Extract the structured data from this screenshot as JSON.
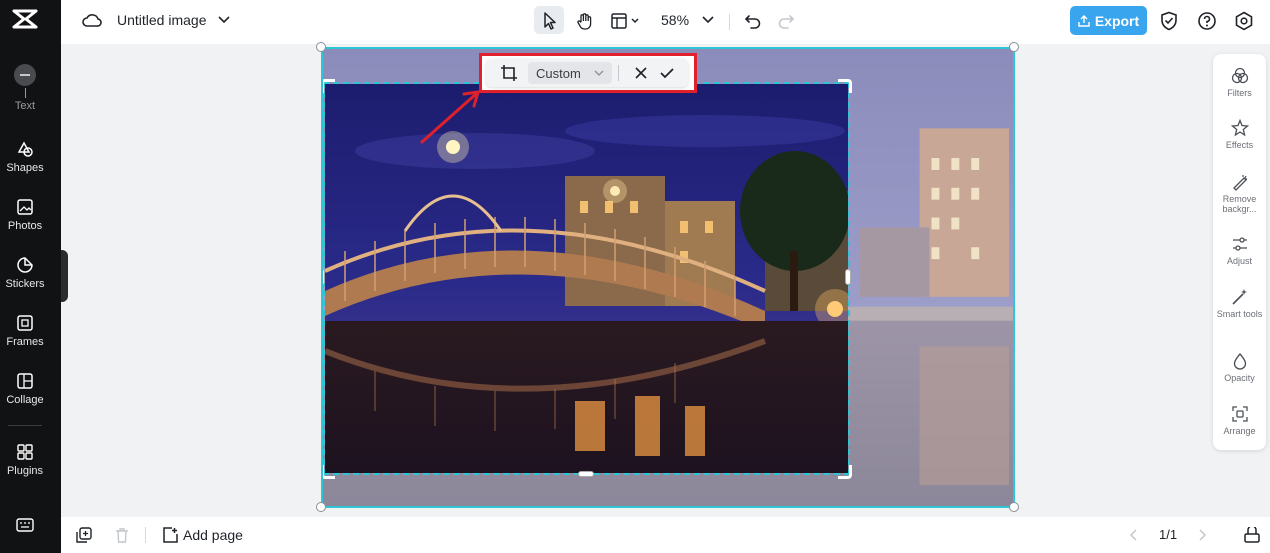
{
  "app": {
    "doc_title": "Untitled image",
    "zoom": "58%",
    "export_label": "Export",
    "add_page_label": "Add page",
    "page_indicator": "1/1"
  },
  "left_sidebar": {
    "items": [
      {
        "label": "Text",
        "icon": "text-icon"
      },
      {
        "label": "Shapes",
        "icon": "shapes-icon"
      },
      {
        "label": "Photos",
        "icon": "photos-icon"
      },
      {
        "label": "Stickers",
        "icon": "stickers-icon"
      },
      {
        "label": "Frames",
        "icon": "frames-icon"
      },
      {
        "label": "Collage",
        "icon": "collage-icon"
      },
      {
        "label": "Plugins",
        "icon": "plugins-icon"
      }
    ]
  },
  "right_panel": {
    "items": [
      {
        "label": "Filters",
        "icon": "filters-icon"
      },
      {
        "label": "Effects",
        "icon": "effects-icon"
      },
      {
        "label": "Remove backgr...",
        "icon": "remove-background-icon"
      },
      {
        "label": "Adjust",
        "icon": "adjust-icon"
      },
      {
        "label": "Smart tools",
        "icon": "smart-tools-icon"
      },
      {
        "label": "Opacity",
        "icon": "opacity-icon"
      },
      {
        "label": "Arrange",
        "icon": "arrange-icon"
      }
    ]
  },
  "crop_toolbar": {
    "ratio_value": "Custom"
  },
  "colors": {
    "accent": "#39a5ef",
    "selection": "#2ec6d7",
    "highlight": "#e0202a",
    "sidebar_bg": "#111214"
  }
}
